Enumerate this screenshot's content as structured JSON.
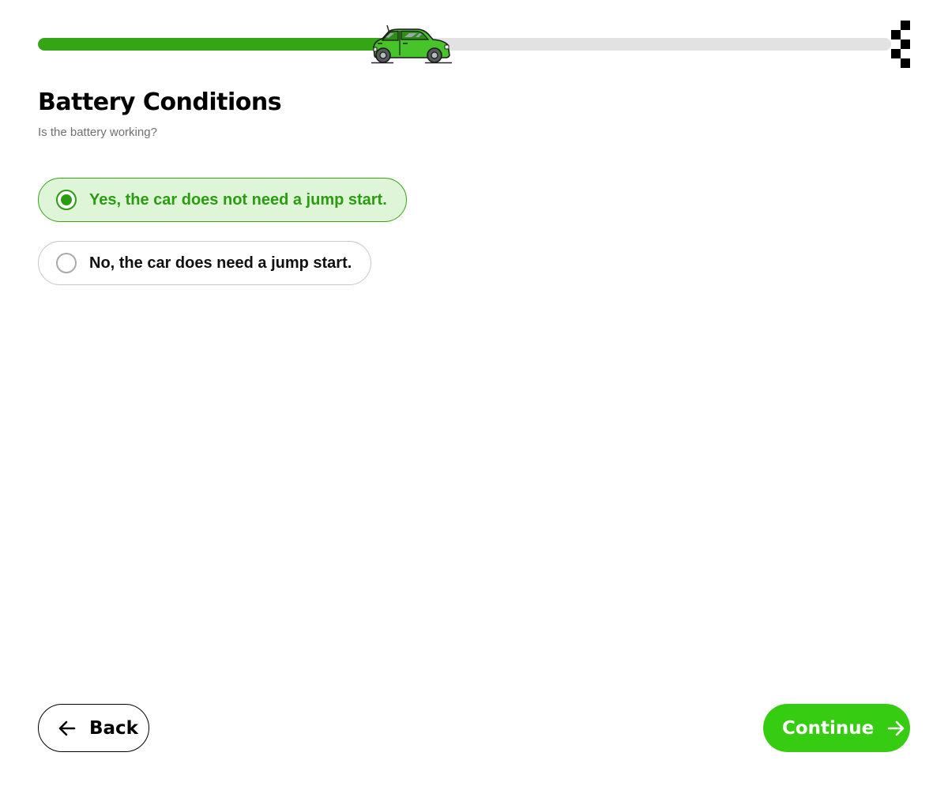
{
  "progress": {
    "fraction": 0.42,
    "fill_color": "#34a514",
    "track_color": "#e2e2e2",
    "marker_icon": "car-icon",
    "end_icon": "finish-flag-icon"
  },
  "question": {
    "title": "Battery Conditions",
    "subtitle": "Is the battery working?"
  },
  "options": [
    {
      "label": "Yes, the car does not need a jump start.",
      "selected": true
    },
    {
      "label": "No, the car does need a jump start.",
      "selected": false
    }
  ],
  "footer": {
    "back_label": "Back",
    "continue_label": "Continue",
    "back_icon": "arrow-left-icon",
    "continue_icon": "arrow-right-icon"
  },
  "colors": {
    "accent": "#36cc12",
    "selected_bg": "#dff5d8",
    "selected_text": "#2a9c10"
  }
}
